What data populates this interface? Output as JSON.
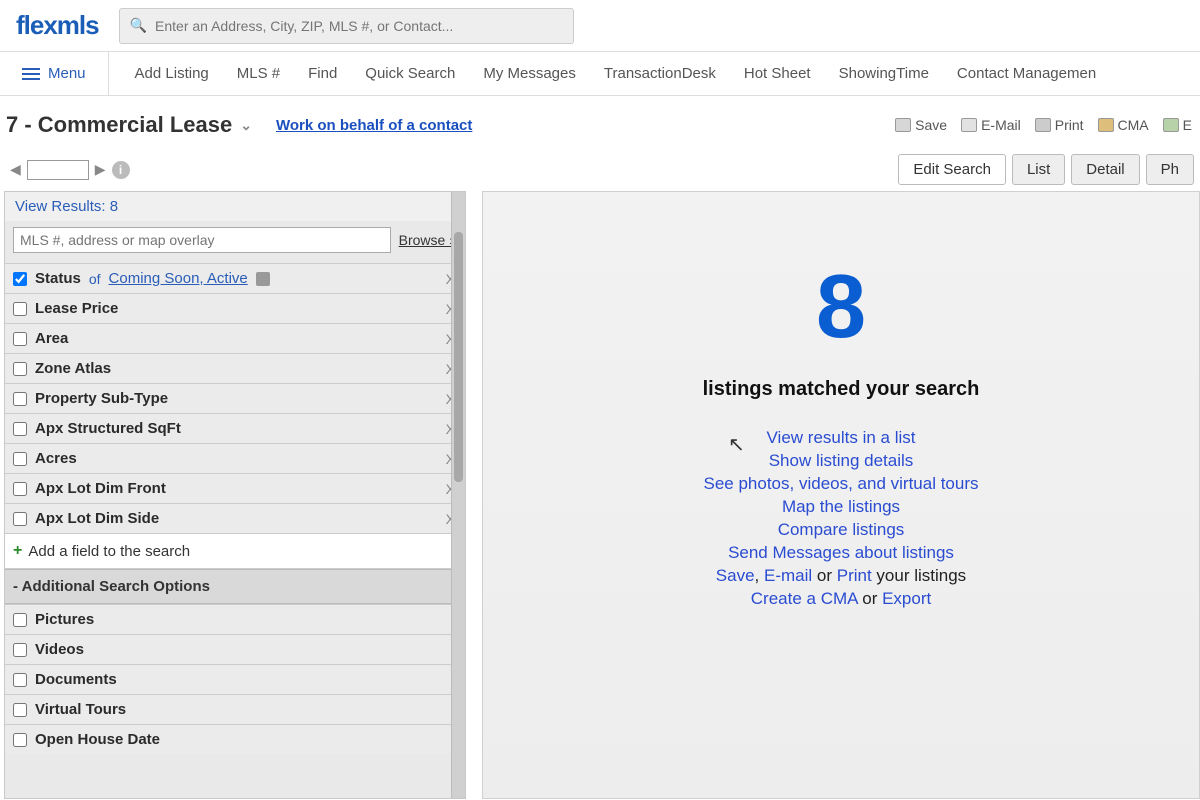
{
  "header": {
    "logo": "flexmls",
    "search_placeholder": "Enter an Address, City, ZIP, MLS #, or Contact..."
  },
  "nav": {
    "menu_label": "Menu",
    "items": [
      "Add Listing",
      "MLS #",
      "Find",
      "Quick Search",
      "My Messages",
      "TransactionDesk",
      "Hot Sheet",
      "ShowingTime",
      "Contact Managemen"
    ]
  },
  "title": {
    "text": "7 - Commercial Lease",
    "behalf_link": "Work on behalf of a contact"
  },
  "actions": {
    "save": "Save",
    "email": "E-Mail",
    "print": "Print",
    "cma": "CMA",
    "export": "E"
  },
  "tabs": [
    "Edit Search",
    "List",
    "Detail",
    "Ph"
  ],
  "left": {
    "view_results_prefix": "View Results: ",
    "view_results_count": "8",
    "filter_placeholder": "MLS #, address or map overlay",
    "browse": "Browse »",
    "status_label": "Status",
    "status_of": "of",
    "status_value": "Coming Soon, Active",
    "fields": [
      "Lease Price",
      "Area",
      "Zone Atlas",
      "Property Sub-Type",
      "Apx Structured SqFt",
      "Acres",
      "Apx Lot Dim Front",
      "Apx Lot Dim Side"
    ],
    "add_field": "Add a field to the search",
    "additional_header": "- Additional Search Options",
    "additional_fields": [
      "Pictures",
      "Videos",
      "Documents",
      "Virtual Tours",
      "Open House Date"
    ]
  },
  "right": {
    "count": "8",
    "message": "listings matched your search",
    "links": {
      "view_list": "View results in a list",
      "show_details": "Show listing details",
      "see_media": "See photos, videos, and virtual tours",
      "map": "Map the listings",
      "compare": "Compare listings",
      "send_msgs": "Send Messages about listings",
      "save": "Save",
      "email": "E-mail",
      "or1": " or ",
      "print": "Print",
      "tail1": " your listings",
      "cma": "Create a CMA",
      "or2": " or ",
      "export": "Export"
    }
  }
}
